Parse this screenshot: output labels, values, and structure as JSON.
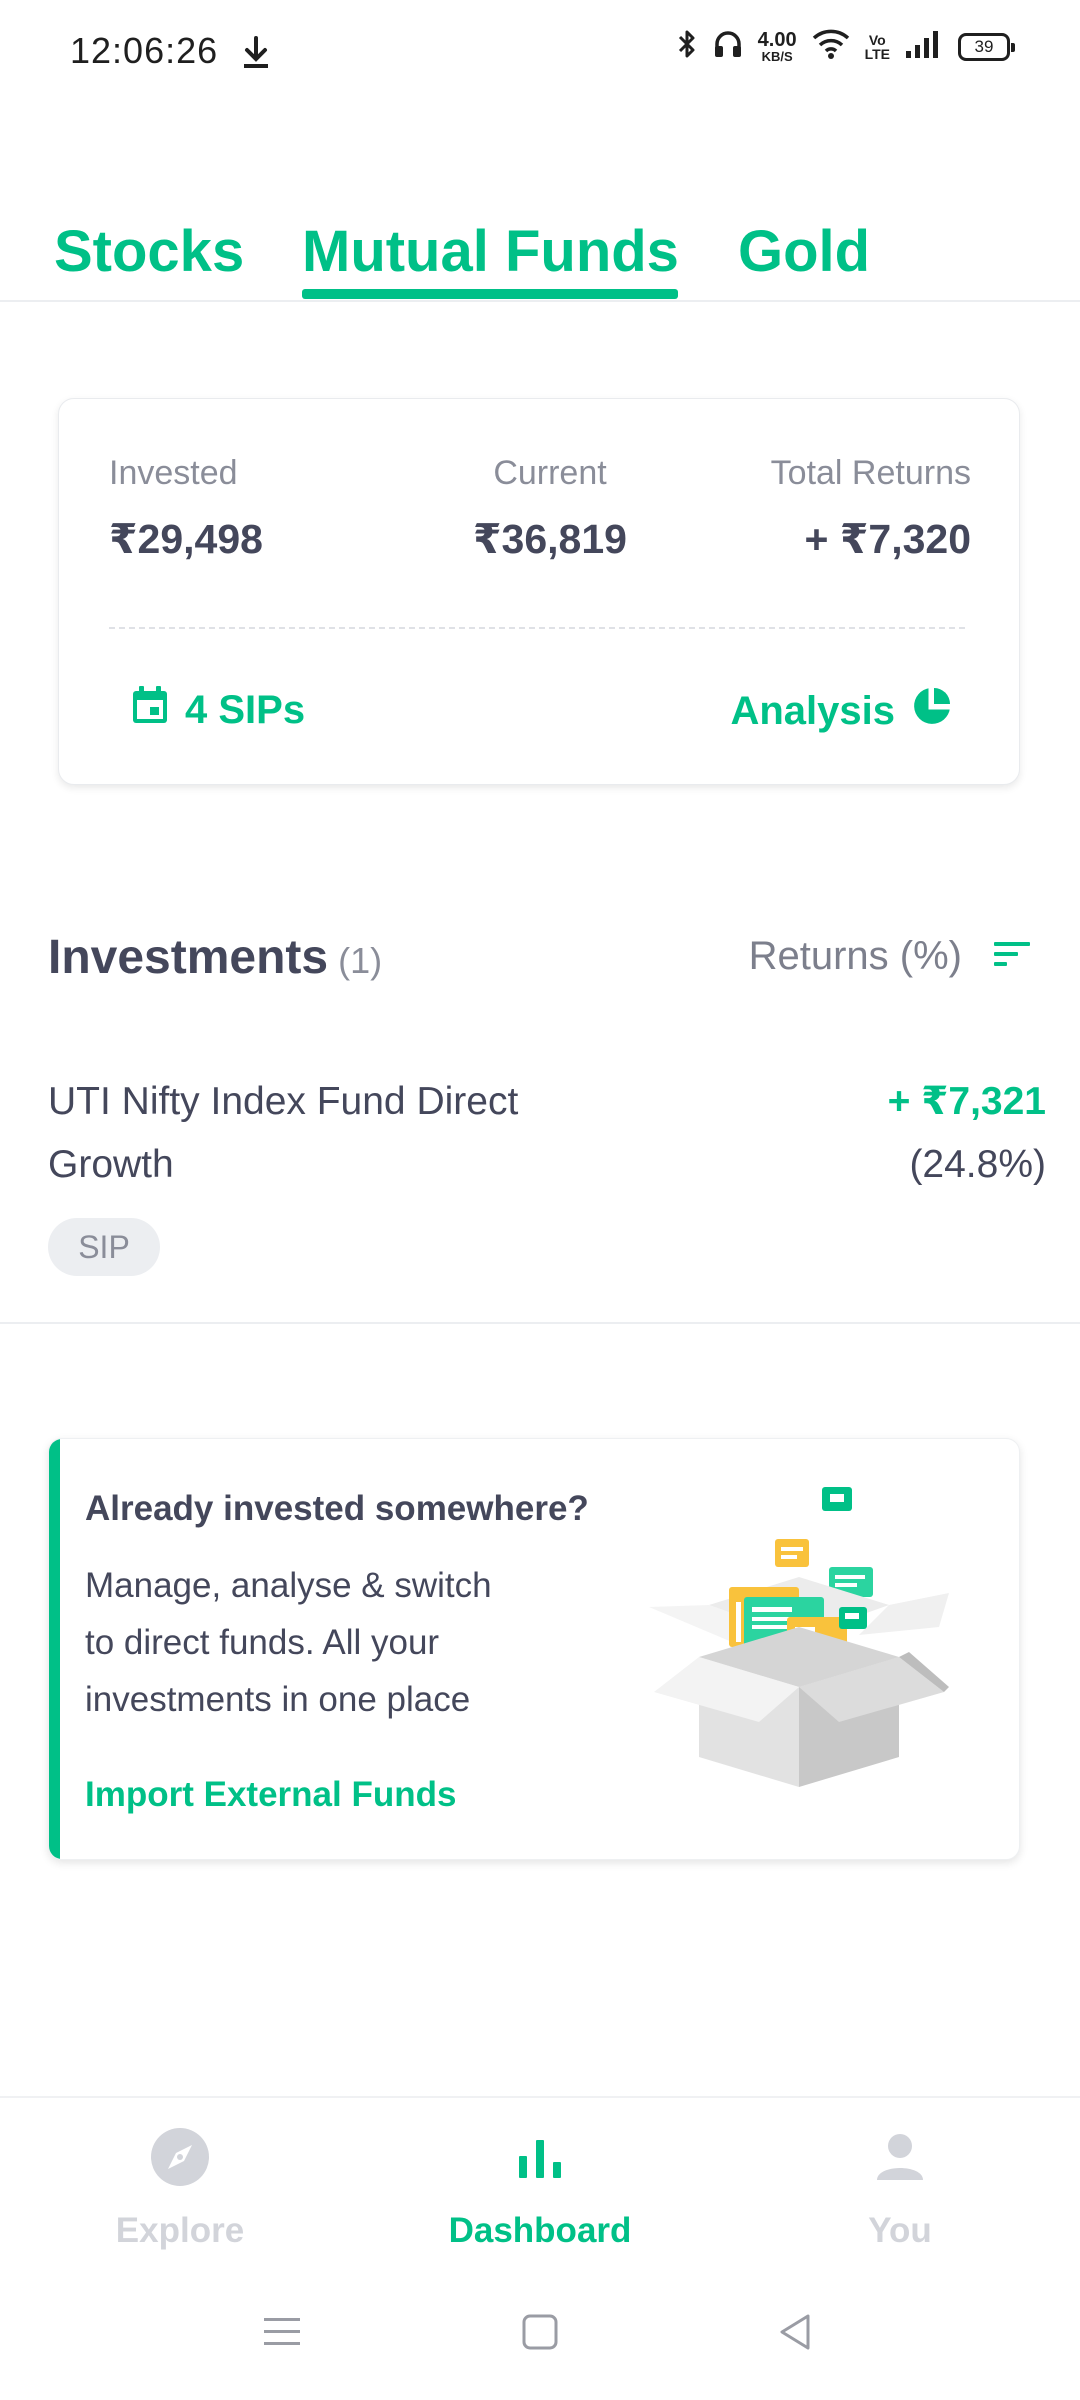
{
  "status_bar": {
    "time": "12:06:26",
    "net_speed_value": "4.00",
    "net_speed_unit": "KB/S",
    "volte_top": "Vo",
    "volte_bottom": "LTE",
    "battery": "39"
  },
  "tabs": [
    {
      "label": "Stocks",
      "active": false
    },
    {
      "label": "Mutual Funds",
      "active": true
    },
    {
      "label": "Gold",
      "active": false
    }
  ],
  "summary": {
    "invested_label": "Invested",
    "invested_value": "₹29,498",
    "current_label": "Current",
    "current_value": "₹36,819",
    "returns_label": "Total Returns",
    "returns_value": "+ ₹7,320",
    "sips_label": "4 SIPs",
    "analysis_label": "Analysis"
  },
  "investments": {
    "title": "Investments",
    "count": "(1)",
    "sort_label": "Returns (%)",
    "items": [
      {
        "name": "UTI Nifty Index Fund Direct Growth",
        "returns_abs": "+ ₹7,321",
        "returns_pct": "(24.8%)",
        "tag": "SIP"
      }
    ]
  },
  "import_card": {
    "title": "Already invested somewhere?",
    "description": "Manage, analyse & switch to direct funds. All your investments in one place",
    "link": "Import External Funds"
  },
  "bottom_nav": [
    {
      "label": "Explore",
      "icon": "compass-icon",
      "active": false
    },
    {
      "label": "Dashboard",
      "icon": "bar-chart-icon",
      "active": true
    },
    {
      "label": "You",
      "icon": "person-icon",
      "active": false
    }
  ],
  "colors": {
    "accent": "#00c087",
    "text_primary": "#44475b",
    "text_secondary": "#8a8d99",
    "nav_inactive": "#d2d4da"
  }
}
